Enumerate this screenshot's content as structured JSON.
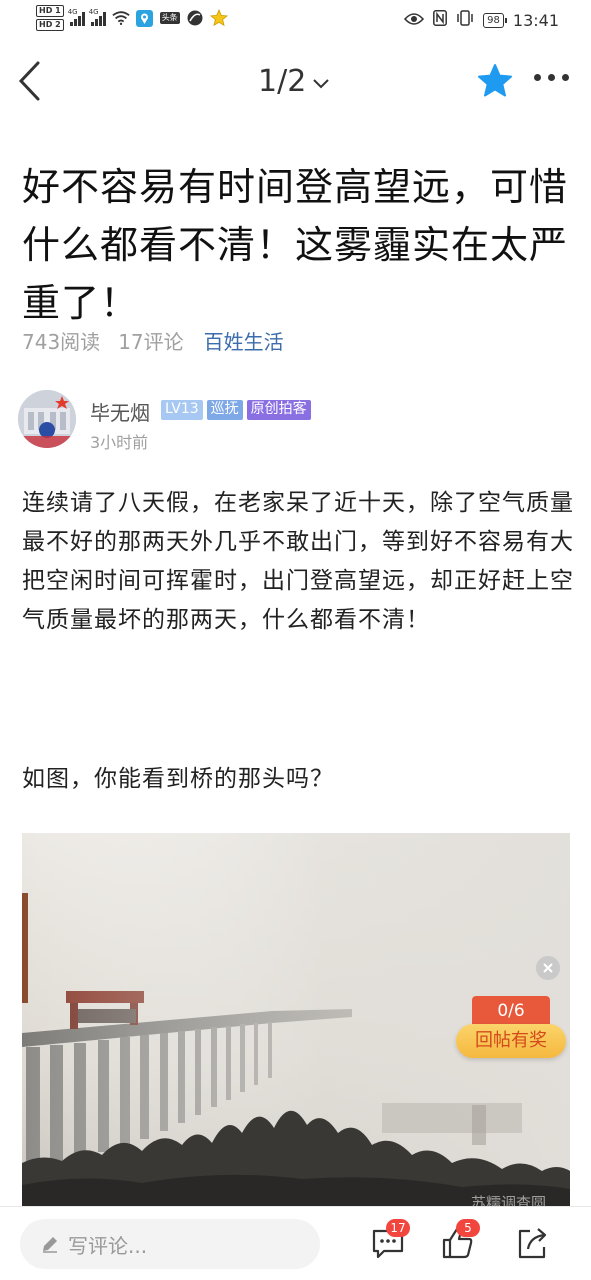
{
  "status_bar": {
    "hd1": "HD 1",
    "hd2": "HD 2",
    "sig1_tag": "4G",
    "sig2_tag": "4G",
    "news_icon_label": "头条",
    "battery": "98",
    "time": "13:41"
  },
  "nav": {
    "pager": "1/2"
  },
  "post": {
    "title": "好不容易有时间登高望远，可惜什么都看不清！这雾霾实在太严重了！",
    "reads": "743阅读",
    "comments": "17评论",
    "channel": "百姓生活",
    "author": "毕无烟",
    "badge_level": "LV13",
    "badge_patrol": "巡抚",
    "badge_original": "原创拍客",
    "time": "3小时前",
    "paragraph1": "连续请了八天假，在老家呆了近十天，除了空气质量最不好的那两天外几乎不敢出门，等到好不容易有大把空闲时间可挥霍时，出门登高望远，却正好赶上空气质量最坏的那两天，什么都看不清！",
    "paragraph2": "如图，你能看到桥的那头吗？",
    "image_watermark": "苏糯调查圆"
  },
  "reward": {
    "count": "0/6",
    "label": "回帖有奖"
  },
  "bottom_bar": {
    "comment_placeholder": "写评论...",
    "comment_badge": "17",
    "like_badge": "5"
  },
  "colors": {
    "channel": "#3c6cab",
    "star": "#1e9bf0",
    "reward_orange": "#e8593c",
    "badge_red": "#f2453d"
  }
}
